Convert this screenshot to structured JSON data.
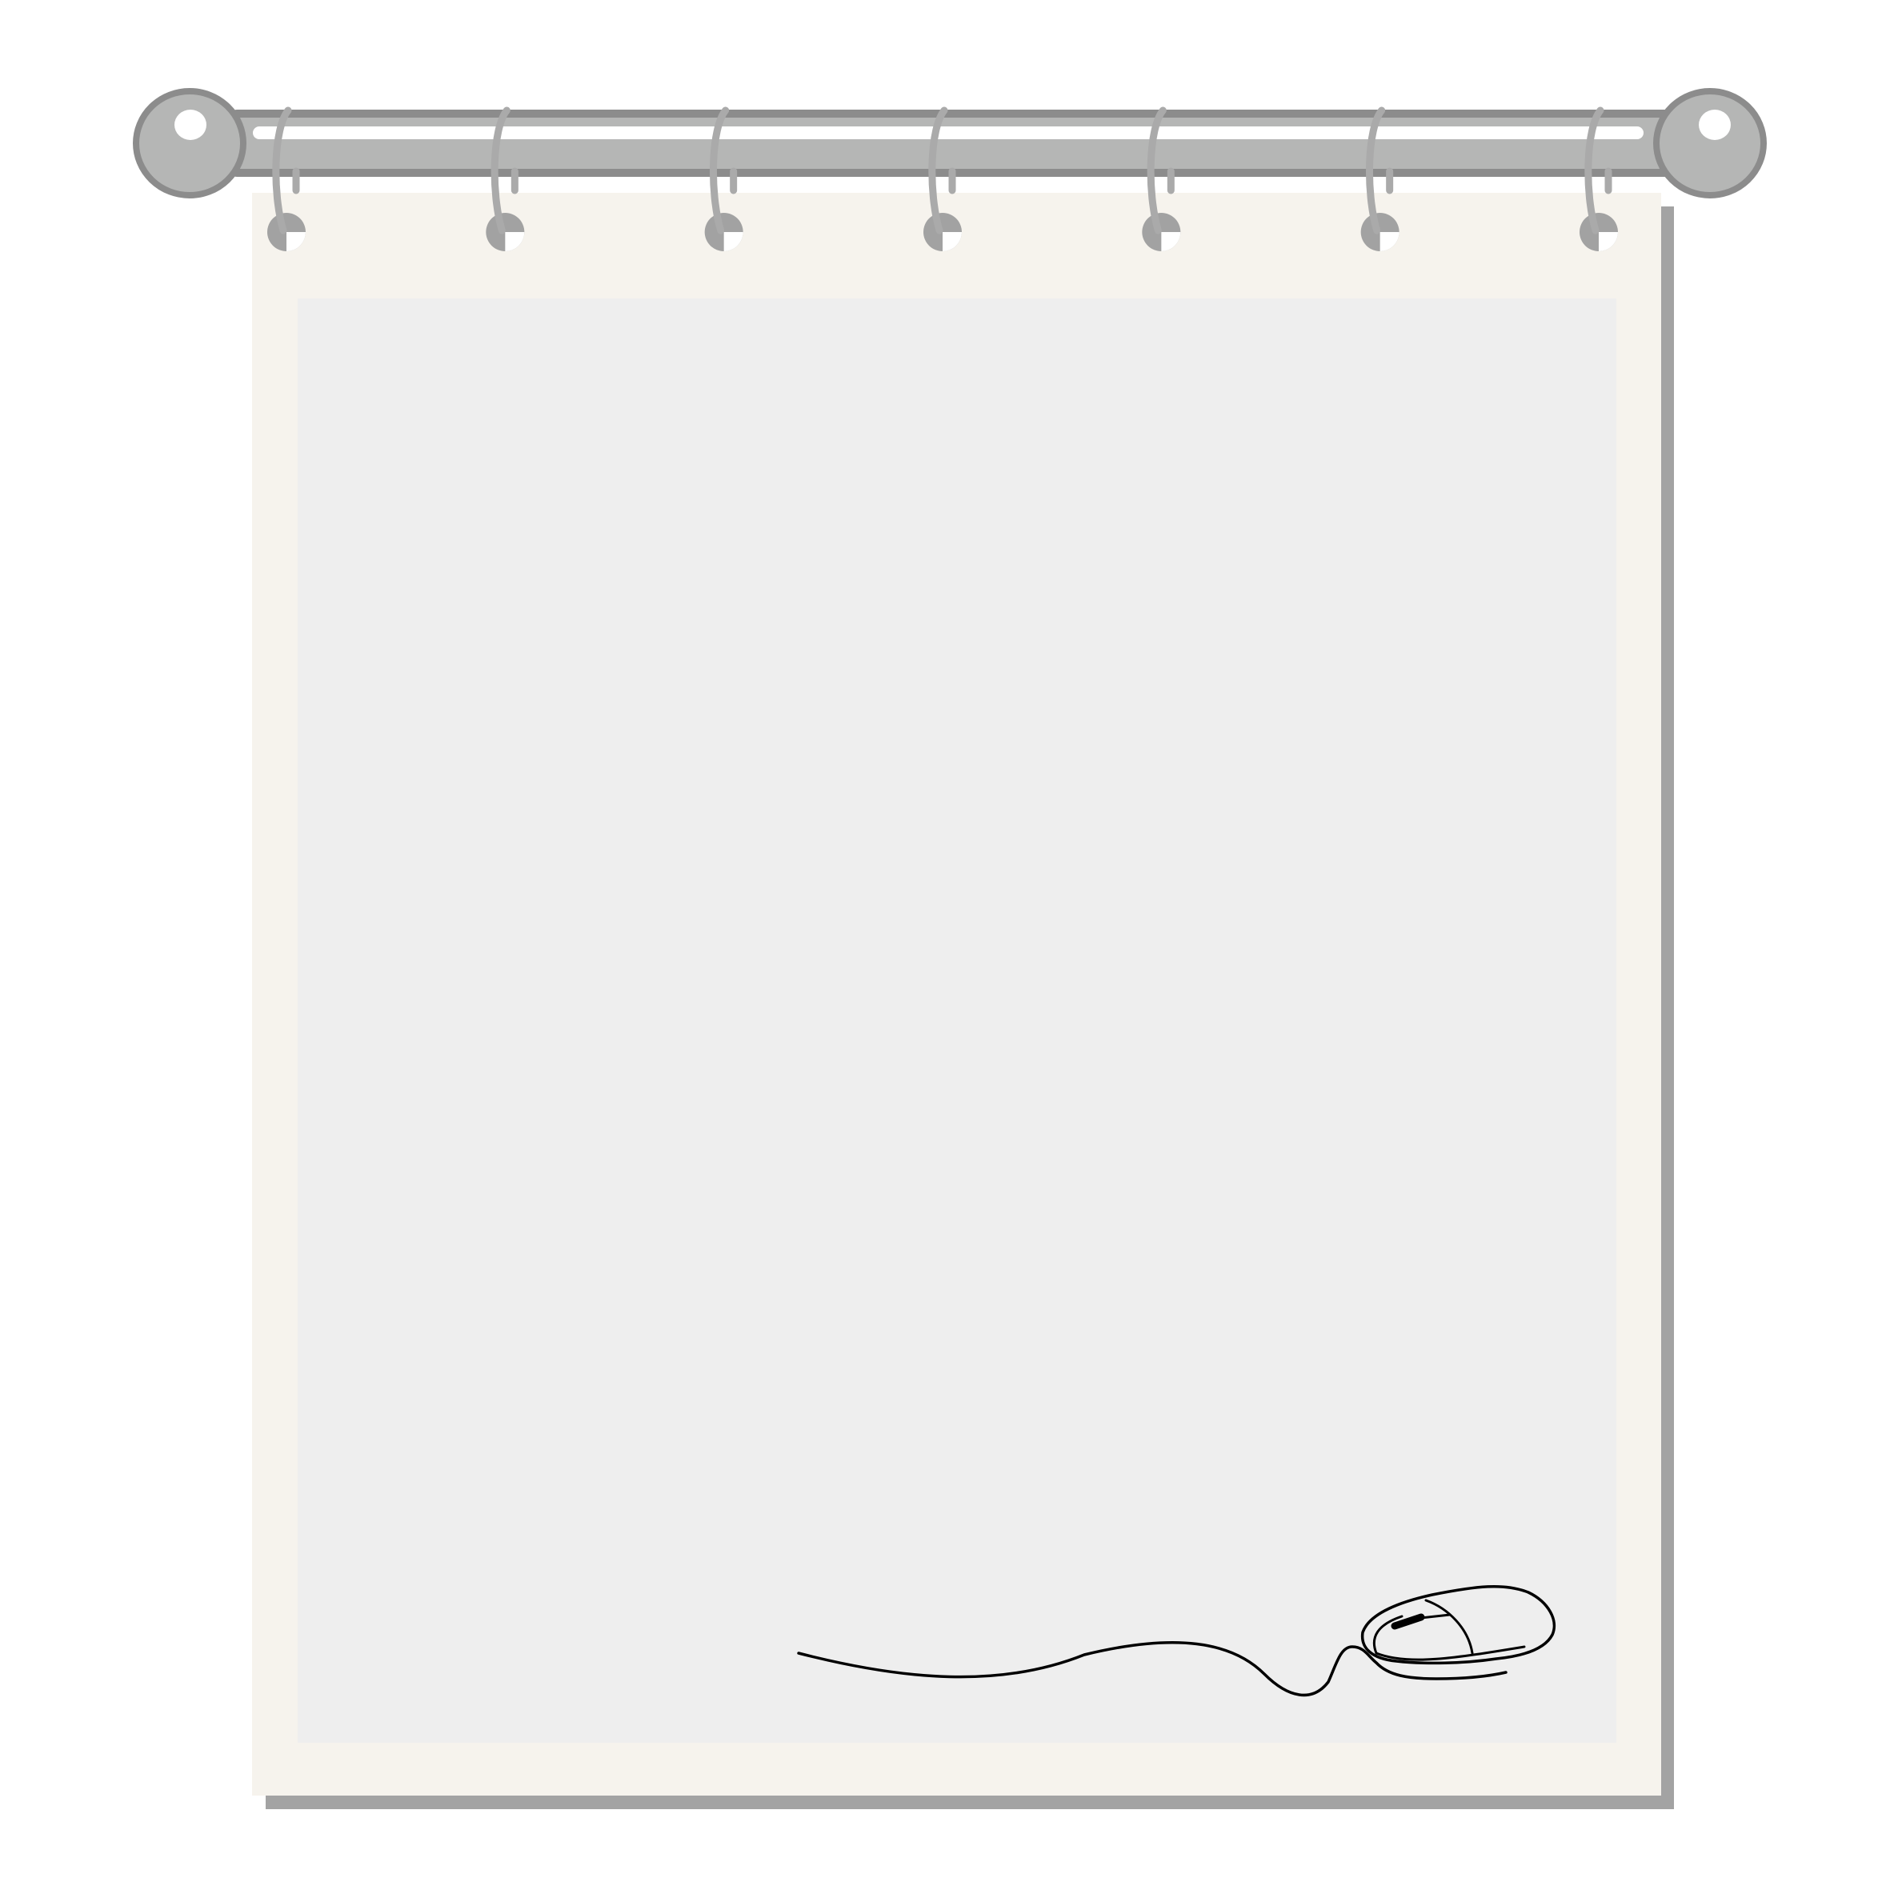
{
  "colors": {
    "background": "#ffffff",
    "page_shadow": "#a3a3a3",
    "page": "#f6f3ed",
    "content_area": "#eeeeee",
    "rod_outline": "#8c8c8c",
    "rod_fill": "#b5b6b5",
    "rod_highlight": "#ffffff",
    "ring": "#aaaaaa",
    "hole": "#a2a2a2",
    "mouse_line": "#000000"
  },
  "icons": {
    "rod": "curtain-rod",
    "rings": "binder-rings",
    "mouse": "computer-mouse-icon"
  },
  "ring_count": 7
}
